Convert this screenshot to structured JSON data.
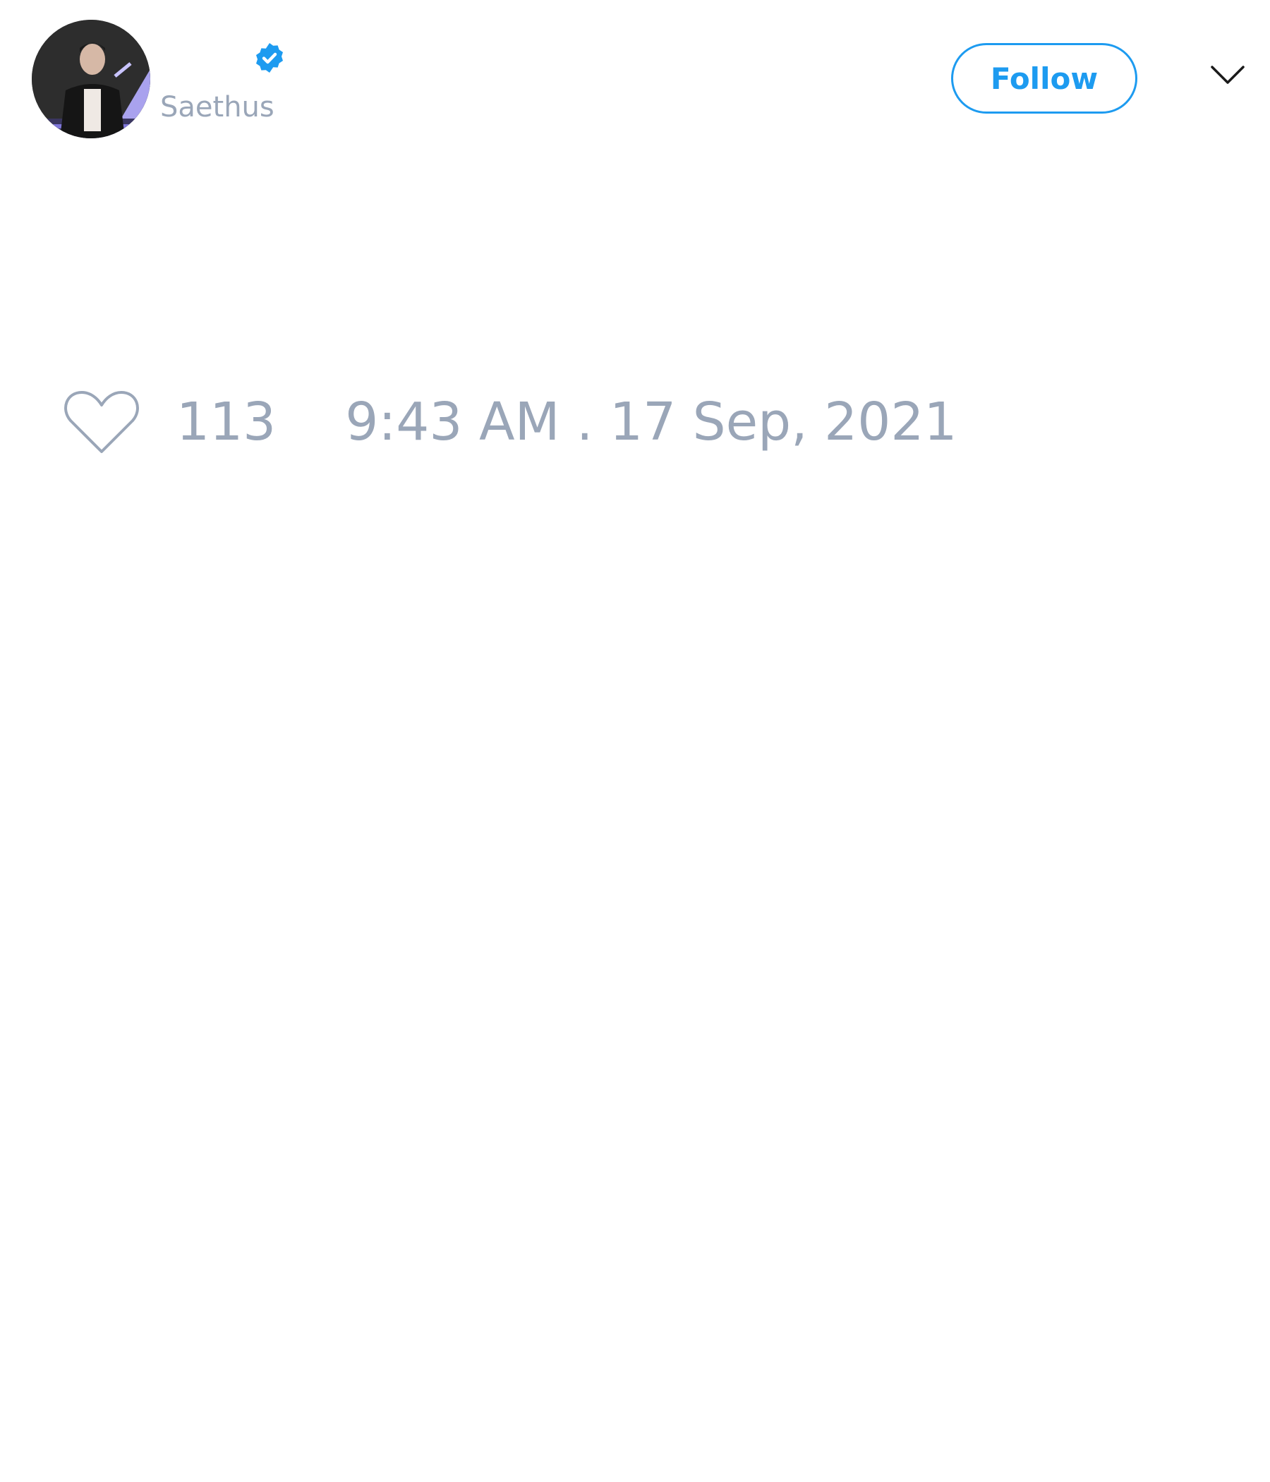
{
  "author": {
    "display_name": "",
    "handle": "Saethus",
    "verified": true,
    "avatar_icon": "profile-photo"
  },
  "header": {
    "follow_label": "Follow",
    "menu_icon": "chevron-down-icon"
  },
  "engagement": {
    "like_icon": "heart-outline-icon",
    "like_count": "113",
    "timestamp": "9:43 AM . 17 Sep, 2021"
  },
  "colors": {
    "accent": "#1d9bf0",
    "muted_text": "#9aa6b8",
    "background": "#ffffff"
  }
}
